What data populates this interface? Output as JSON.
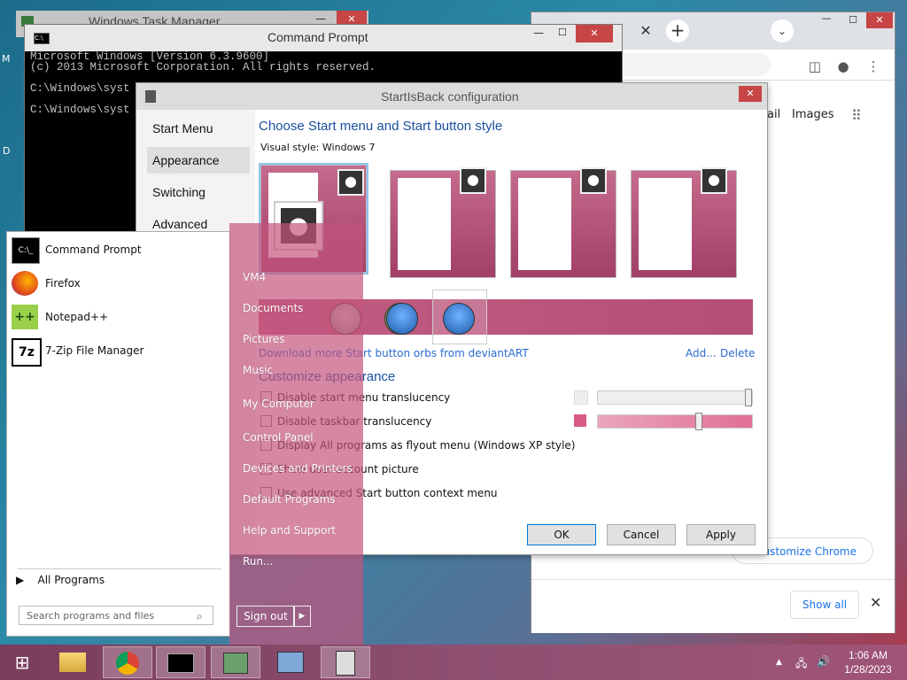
{
  "taskmgr": {
    "title": "Windows Task Manager"
  },
  "cmd": {
    "title": "Command Prompt",
    "lines": [
      "Microsoft Windows [Version 6.3.9600]",
      "(c) 2013 Microsoft Corporation. All rights reserved.",
      "",
      "C:\\Windows\\syst",
      "",
      "C:\\Windows\\syst"
    ]
  },
  "chrome": {
    "gmail": "ail",
    "images": "Images",
    "customize": "Customize Chrome",
    "show_all": "Show all"
  },
  "sib": {
    "title": "StartIsBack configuration",
    "nav": [
      "Start Menu",
      "Appearance",
      "Switching",
      "Advanced"
    ],
    "heading": "Choose Start menu and Start button style",
    "visual_style_label": "Visual style:",
    "visual_style_value": "Windows 7",
    "orbs_link": "Download more Start button orbs from deviantART",
    "add_link": "Add...",
    "delete_link": "Delete",
    "customize_heading": "Customize appearance",
    "options": [
      "Disable start menu translucency",
      "Disable taskbar translucency",
      "Display All programs as flyout menu (Windows XP style)",
      "Show user account picture",
      "Use advanced Start button context menu"
    ],
    "buttons": {
      "ok": "OK",
      "cancel": "Cancel",
      "apply": "Apply"
    },
    "colors": {
      "accent": "#c4587f",
      "link": "#2a6bd1",
      "heading": "#1b4fa0"
    }
  },
  "start": {
    "programs": [
      {
        "label": "Command Prompt",
        "icon": "cmd-icon"
      },
      {
        "label": "Firefox",
        "icon": "firefox-icon"
      },
      {
        "label": "Notepad++",
        "icon": "notepadpp-icon"
      },
      {
        "label": "7-Zip File Manager",
        "icon": "sevenzip-icon"
      }
    ],
    "all_programs": "All Programs",
    "search_placeholder": "Search programs and files",
    "right_links": [
      "VM4",
      "Documents",
      "Pictures",
      "Music",
      "My Computer",
      "Control Panel",
      "Devices and Printers",
      "Default Programs",
      "Help and Support",
      "Run..."
    ],
    "sign_out": "Sign out"
  },
  "taskbar": {
    "time": "1:06 AM",
    "date": "1/28/2023"
  }
}
